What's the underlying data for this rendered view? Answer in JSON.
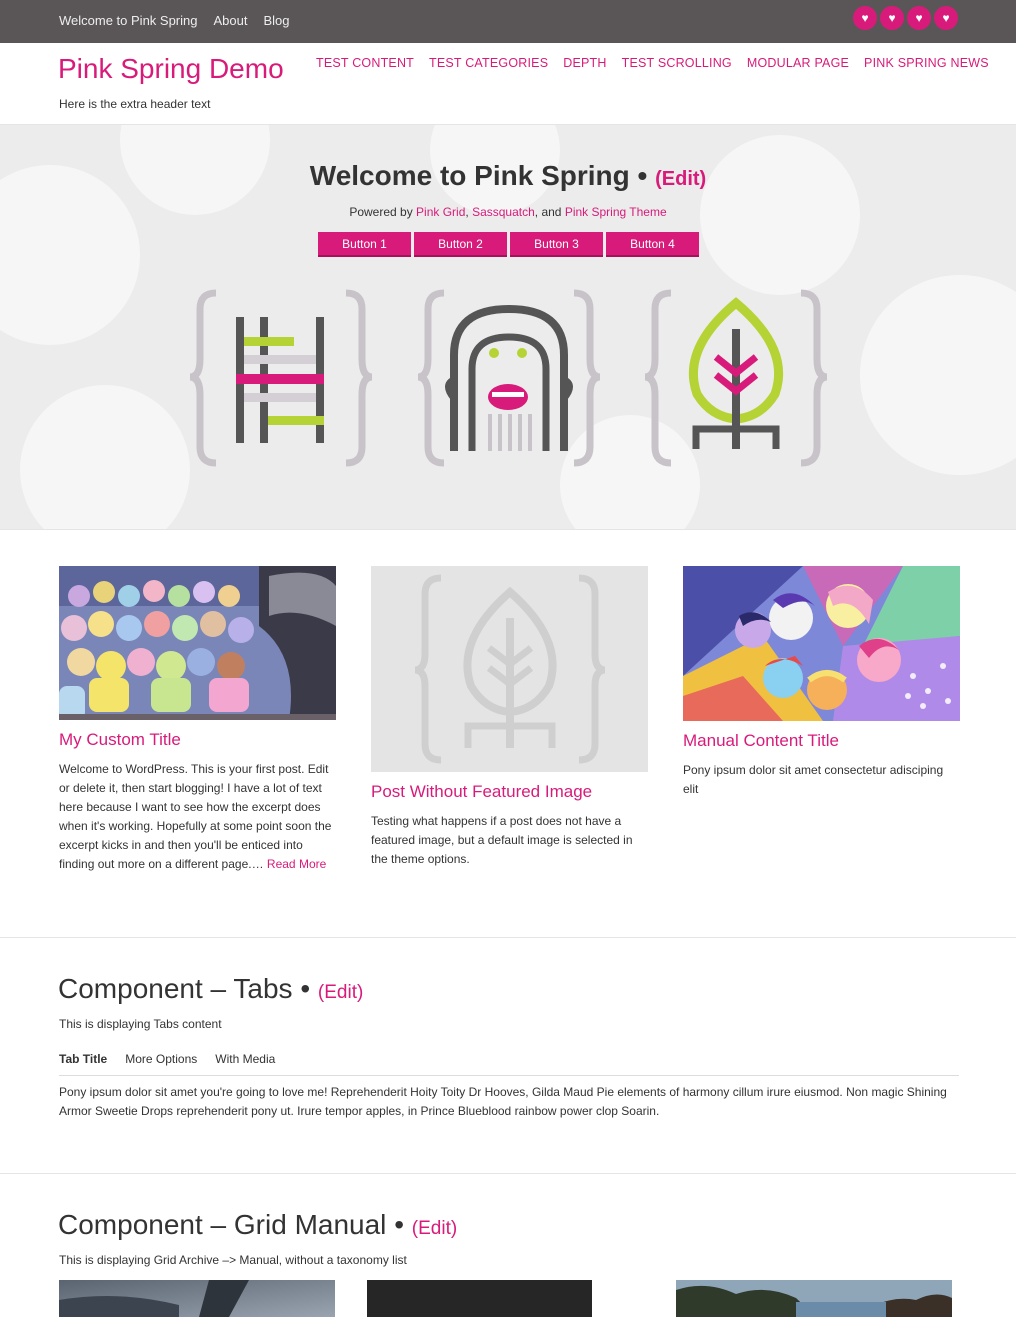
{
  "topbar": {
    "links": [
      "Welcome to Pink Spring",
      "About",
      "Blog"
    ],
    "social_icons": [
      "heart-icon",
      "heart-icon",
      "heart-icon",
      "heart-icon"
    ]
  },
  "header": {
    "title": "Pink Spring Demo",
    "extra_text": "Here is the extra header text",
    "nav": [
      "TEST CONTENT",
      "TEST CATEGORIES",
      "DEPTH",
      "TEST SCROLLING",
      "MODULAR PAGE",
      "PINK SPRING NEWS"
    ]
  },
  "hero": {
    "title": "Welcome to Pink Spring",
    "bullet": "•",
    "edit": "(Edit)",
    "powered_prefix": "Powered by ",
    "link1": "Pink Grid",
    "sep1": ", ",
    "link2": "Sassquatch",
    "sep2": ", and ",
    "link3": "Pink Spring Theme",
    "buttons": [
      "Button 1",
      "Button 2",
      "Button 3",
      "Button 4"
    ]
  },
  "cards": [
    {
      "title": "My Custom Title",
      "excerpt": "Welcome to WordPress. This is your first post. Edit or delete it, then start blogging! I have a lot of text here because I want to see how the excerpt does when it's working. Hopefully at some point soon the excerpt kicks in and then you'll be enticed into finding out more on a different page.… ",
      "read_more": "Read More"
    },
    {
      "title": "Post Without Featured Image",
      "excerpt": "Testing what happens if a post does not have a featured image, but a default image is selected in the theme options."
    },
    {
      "title": "Manual Content Title",
      "excerpt": "Pony ipsum dolor sit amet consectetur adisciping elit"
    }
  ],
  "tabs_section": {
    "title": "Component – Tabs",
    "bullet": "•",
    "edit": "(Edit)",
    "desc": "This is displaying Tabs content",
    "tabs": [
      "Tab Title",
      "More Options",
      "With Media"
    ],
    "content": "Pony ipsum dolor sit amet you're going to love me! Reprehenderit Hoity Toity Dr Hooves, Gilda Maud Pie elements of harmony cillum irure eiusmod. Non magic Shining Armor Sweetie Drops reprehenderit pony ut. Irure tempor apples, in Prince Blueblood rainbow power clop Soarin."
  },
  "grid_section": {
    "title": "Component – Grid Manual",
    "bullet": "•",
    "edit": "(Edit)",
    "desc": "This is displaying Grid Archive –> Manual, without a taxonomy list"
  },
  "colors": {
    "accent": "#d81b7a",
    "topbar": "#5a5557",
    "lime": "#b5d335"
  }
}
